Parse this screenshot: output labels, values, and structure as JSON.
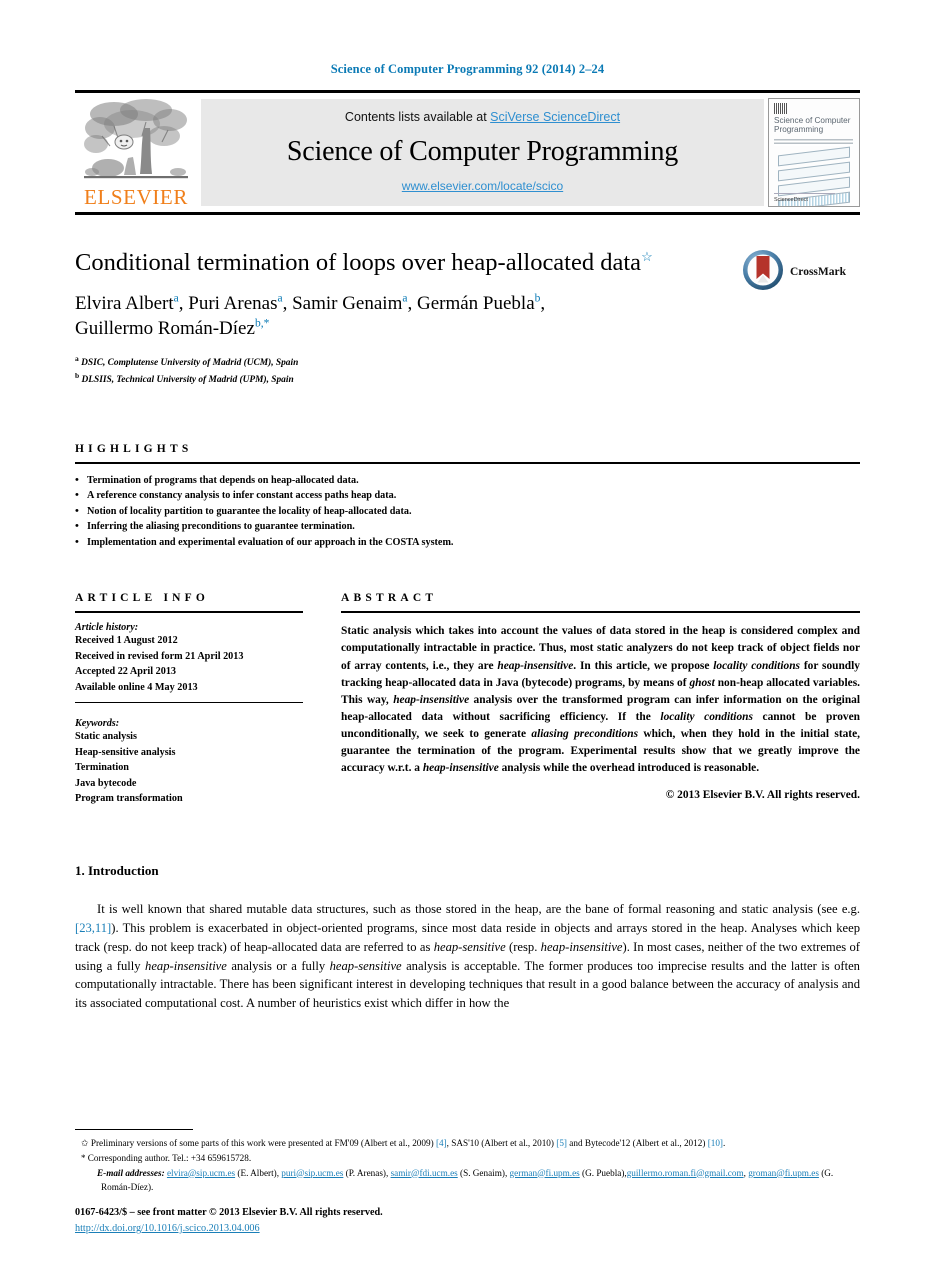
{
  "running_head": "Science of Computer Programming 92 (2014) 2–24",
  "masthead": {
    "contents_prefix": "Contents lists available at ",
    "sciencedirect_link": "SciVerse ScienceDirect",
    "journal_name": "Science of Computer Programming",
    "journal_url": "www.elsevier.com/locate/scico",
    "publisher_word": "ELSEVIER",
    "publisher_color": "#f07f1a",
    "link_color": "#2f8fd0",
    "cover": {
      "title_line1": "Science of Computer",
      "title_line2": "Programming",
      "footer": "ScienceDirect"
    }
  },
  "article": {
    "title": "Conditional termination of loops over heap-allocated data",
    "title_footnote_mark": "☆",
    "authors_line1": "Elvira Albert",
    "authors": [
      {
        "name": "Elvira Albert",
        "sup": "a",
        "sep": ", "
      },
      {
        "name": "Puri Arenas",
        "sup": "a",
        "sep": ", "
      },
      {
        "name": "Samir Genaim",
        "sup": "a",
        "sep": ", "
      },
      {
        "name": "Germán Puebla",
        "sup": "b",
        "sep": ","
      },
      {
        "name": "Guillermo Román-Díez",
        "sup": "b,*",
        "sep": ""
      }
    ],
    "affiliations": [
      {
        "mark": "a",
        "text": "DSIC, Complutense University of Madrid (UCM), Spain"
      },
      {
        "mark": "b",
        "text": "DLSIIS, Technical University of Madrid (UPM), Spain"
      }
    ],
    "crossmark_label": "CrossMark"
  },
  "highlights": {
    "heading": "HIGHLIGHTS",
    "items": [
      "Termination of programs that depends on heap-allocated data.",
      "A reference constancy analysis to infer constant access paths heap data.",
      "Notion of locality partition to guarantee the locality of heap-allocated data.",
      "Inferring the aliasing preconditions to guarantee termination.",
      "Implementation and experimental evaluation of our approach in the COSTA system."
    ]
  },
  "article_info": {
    "heading": "ARTICLE INFO",
    "history_label": "Article history:",
    "history": [
      "Received 1 August 2012",
      "Received in revised form 21 April 2013",
      "Accepted 22 April 2013",
      "Available online 4 May 2013"
    ],
    "keywords_label": "Keywords:",
    "keywords": [
      "Static analysis",
      "Heap-sensitive analysis",
      "Termination",
      "Java bytecode",
      "Program transformation"
    ]
  },
  "abstract": {
    "heading": "ABSTRACT",
    "paragraphs": [
      "Static analysis which takes into account the values of data stored in the heap is considered complex and computationally intractable in practice. Thus, most static analyzers do not keep track of object fields nor of array contents, i.e., they are heap-insensitive. In this article, we propose locality conditions for soundly tracking heap-allocated data in Java (bytecode) programs, by means of ghost non-heap allocated variables. This way, heap-insensitive analysis over the transformed program can infer information on the original heap-allocated data without sacrificing efficiency. If the locality conditions cannot be proven unconditionally, we seek to generate aliasing preconditions which, when they hold in the initial state, guarantee the termination of the program. Experimental results show that we greatly improve the accuracy w.r.t. a heap-insensitive analysis while the overhead introduced is reasonable."
    ],
    "copyright": "© 2013 Elsevier B.V. All rights reserved."
  },
  "introduction": {
    "heading": "1. Introduction",
    "text": "It is well known that shared mutable data structures, such as those stored in the heap, are the bane of formal reasoning and static analysis (see e.g. [23,11]). This problem is exacerbated in object-oriented programs, since most data reside in objects and arrays stored in the heap. Analyses which keep track (resp. do not keep track) of heap-allocated data are referred to as heap-sensitive (resp. heap-insensitive). In most cases, neither of the two extremes of using a fully heap-insensitive analysis or a fully heap-sensitive analysis is acceptable. The former produces too imprecise results and the latter is often computationally intractable. There has been significant interest in developing techniques that result in a good balance between the accuracy of analysis and its associated computational cost. A number of heuristics exist which differ in how the",
    "citation": "[23,11]"
  },
  "footnotes": {
    "star_mark": "✩",
    "star_text_a": "Preliminary versions of some parts of this work were presented at FM'09 (Albert et al., 2009) ",
    "star_ref1": "[4]",
    "star_text_b": ", SAS'10 (Albert et al., 2010) ",
    "star_ref2": "[5]",
    "star_text_c": " and Bytecode'12 (Albert et al., 2012) ",
    "star_ref3": "[10]",
    "star_text_d": ".",
    "corresponding_mark": "*",
    "corresponding_text": "Corresponding author. Tel.: +34 659615728.",
    "email_label": "E-mail addresses:",
    "emails": [
      {
        "address": "elvira@sip.ucm.es",
        "person": "(E. Albert)",
        "sep": ", "
      },
      {
        "address": "puri@sip.ucm.es",
        "person": "(P. Arenas)",
        "sep": ", "
      },
      {
        "address": "samir@fdi.ucm.es",
        "person": "(S. Genaim)",
        "sep": ", "
      },
      {
        "address": "german@fi.upm.es",
        "person": "(G. Puebla)",
        "sep": ","
      },
      {
        "address": "guillermo.roman.fi@gmail.com",
        "person": "",
        "sep": ", "
      },
      {
        "address": "groman@fi.upm.es",
        "person": "(G. Román-Díez)",
        "sep": "."
      }
    ]
  },
  "imprint": {
    "issn_line": "0167-6423/$ – see front matter © 2013 Elsevier B.V. All rights reserved.",
    "doi": "http://dx.doi.org/10.1016/j.scico.2013.04.006"
  }
}
